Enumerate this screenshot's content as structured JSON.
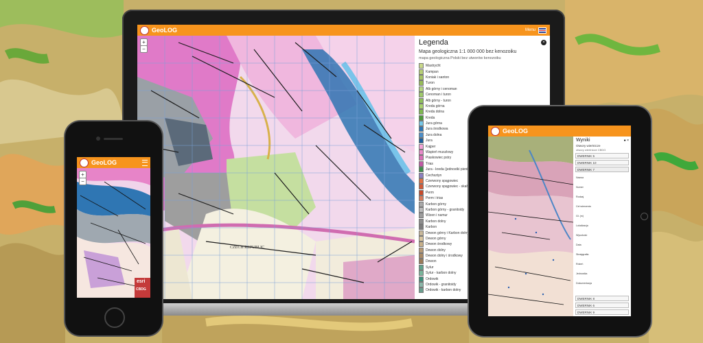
{
  "app": {
    "name": "GeoLOG",
    "menu_label": "Menu"
  },
  "laptop": {
    "legend": {
      "title": "Legenda",
      "subtitle": "Mapa geologiczna 1:1 000 000 bez kenozoiku",
      "caption": "mapa geologiczna Polski bez utworów kenozoiku",
      "items": [
        {
          "label": "Mastrycht",
          "color": "#c9d98a"
        },
        {
          "label": "Kampan",
          "color": "#b7cf75"
        },
        {
          "label": "Koniak i santon",
          "color": "#a8c565"
        },
        {
          "label": "Turon",
          "color": "#97bc58"
        },
        {
          "label": "Alb górny i cenoman",
          "color": "#b5d681"
        },
        {
          "label": "Cenoman i turon",
          "color": "#9fca6b"
        },
        {
          "label": "Alb górny - turon",
          "color": "#8fbf5d"
        },
        {
          "label": "Kreda górna",
          "color": "#a9d36e"
        },
        {
          "label": "Kreda dolna",
          "color": "#7fb851"
        },
        {
          "label": "Kreda",
          "color": "#4d9a3a"
        },
        {
          "label": "Jura górna",
          "color": "#76c7e8"
        },
        {
          "label": "Jura środkowa",
          "color": "#2f76b3"
        },
        {
          "label": "Jura dolna",
          "color": "#4d8fc9"
        },
        {
          "label": "Jura",
          "color": "#1d5f9d"
        },
        {
          "label": "Kajper",
          "color": "#f4a3d8"
        },
        {
          "label": "Wapień muszlowy",
          "color": "#e889c9"
        },
        {
          "label": "Piaskowiec pstry",
          "color": "#d96fb8"
        },
        {
          "label": "Trias",
          "color": "#c25aa6"
        },
        {
          "label": "Jura - kreda (jednostki pienińskie)",
          "color": "#3f8f4c"
        },
        {
          "label": "Cechsztyn",
          "color": "#8c7fc0"
        },
        {
          "label": "Czerwony spągowiec",
          "color": "#e07044"
        },
        {
          "label": "Czerwony spągowiec - skały wulkaniczne",
          "color": "#d25a38"
        },
        {
          "label": "Perm",
          "color": "#c84a2a"
        },
        {
          "label": "Perm i trias",
          "color": "#d77a5a"
        },
        {
          "label": "Karbon górny",
          "color": "#a9a9a9"
        },
        {
          "label": "Karbon górny - granitoidy",
          "color": "#bcbcbc"
        },
        {
          "label": "Wizen i namur",
          "color": "#9d9d9d"
        },
        {
          "label": "Karbon dolny",
          "color": "#8e8e8e"
        },
        {
          "label": "Karbon",
          "color": "#7d7d7d"
        },
        {
          "label": "Dewon górny i Karbon dolny",
          "color": "#c8b89a"
        },
        {
          "label": "Dewon górny",
          "color": "#d9c6a0"
        },
        {
          "label": "Dewon środkowy",
          "color": "#c7b08a"
        },
        {
          "label": "Dewon dolny",
          "color": "#b79a76"
        },
        {
          "label": "Dewon dolny i środkowy",
          "color": "#a98a66"
        },
        {
          "label": "Dewon",
          "color": "#9a7a58"
        },
        {
          "label": "Sylur",
          "color": "#5fa38c"
        },
        {
          "label": "Sylur - karbon dolny",
          "color": "#78b59b"
        },
        {
          "label": "Ordowik",
          "color": "#3f8f7a"
        },
        {
          "label": "Ordowik - granitoidy",
          "color": "#8ab6a8"
        },
        {
          "label": "Ordowik - karbon dolny",
          "color": "#6a9e8e"
        }
      ]
    },
    "map_label": "CZECH REPUBLIC"
  },
  "phone": {
    "esri_label": "esri",
    "cbdg_label": "CBDG"
  },
  "tablet": {
    "panel": {
      "title": "Wyniki",
      "subtitle": "Otwory wiertnicze",
      "caption": "otwory wiertnicze CBDG",
      "sections": [
        "DWERNIK 5",
        "DWERNIK 10",
        "DWERNIK 7",
        "DWERNIK 8",
        "DWERNIK 6",
        "DWERNIK 9"
      ],
      "open_section": "DWERNIK 7",
      "details": [
        "Nazwa",
        "Numer",
        "Rodzaj",
        "Cel wiercenia",
        "Gł. (m)",
        "Lokalizacja",
        "Wysokość",
        "Data",
        "Stratygrafia",
        "Rdzeń",
        "Jednostka",
        "Dokumentacja"
      ]
    }
  }
}
